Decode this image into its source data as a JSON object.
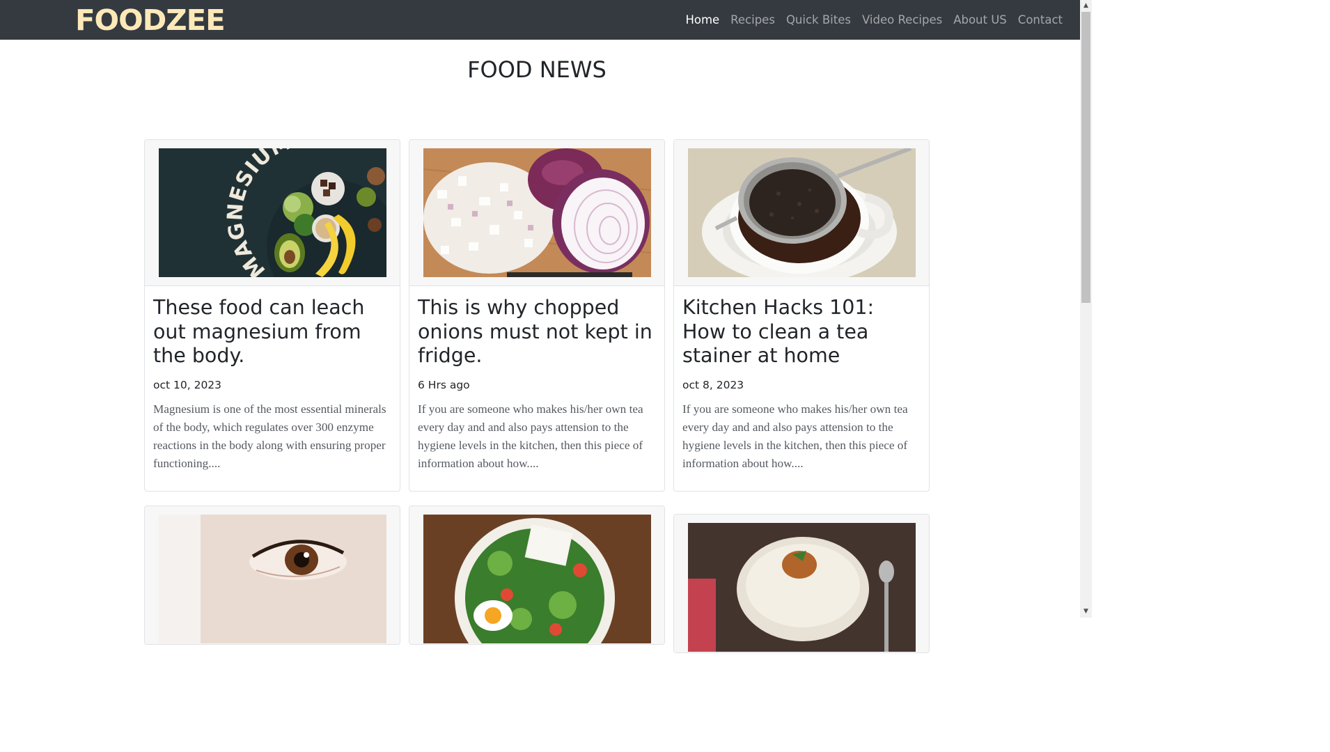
{
  "navbar": {
    "brand": "FOODZEE",
    "links": [
      {
        "label": "Home",
        "active": true
      },
      {
        "label": "Recipes",
        "active": false
      },
      {
        "label": "Quick Bites",
        "active": false
      },
      {
        "label": "Video Recipes",
        "active": false
      },
      {
        "label": "About US",
        "active": false
      },
      {
        "label": "Contact",
        "active": false
      }
    ]
  },
  "page": {
    "title": "FOOD NEWS"
  },
  "cards": [
    {
      "title": "These food can leach out magnesium from the body.",
      "date": "oct 10, 2023",
      "text": "Magnesium is one of the most essential minerals of the body, which regulates over 300 enzyme reactions in the body along with ensuring proper functioning....",
      "image": "magnesium-foods-image",
      "image_text": "MAGNESIUM"
    },
    {
      "title": "This is why chopped onions must not kept in fridge.",
      "date": "6 Hrs ago",
      "text": "If you are someone who makes his/her own tea every day and and also pays attension to the hygiene levels in the kitchen, then this piece of information about how....",
      "image": "chopped-onion-image"
    },
    {
      "title": "Kitchen Hacks 101: How to clean a tea stainer at home",
      "date": "oct 8, 2023",
      "text": "If you are someone who makes his/her own tea every day and and also pays attension to the hygiene levels in the kitchen, then this piece of information about how....",
      "image": "tea-strainer-image"
    }
  ],
  "cards_row2": [
    {
      "image": "eye-closeup-image"
    },
    {
      "image": "salad-bowl-image"
    },
    {
      "image": "rice-curry-image"
    }
  ],
  "colors": {
    "navbar_bg": "#343a40",
    "brand": "#fde9b8",
    "nav_link": "rgba(255,255,255,0.55)",
    "nav_link_active": "#ffffff"
  }
}
